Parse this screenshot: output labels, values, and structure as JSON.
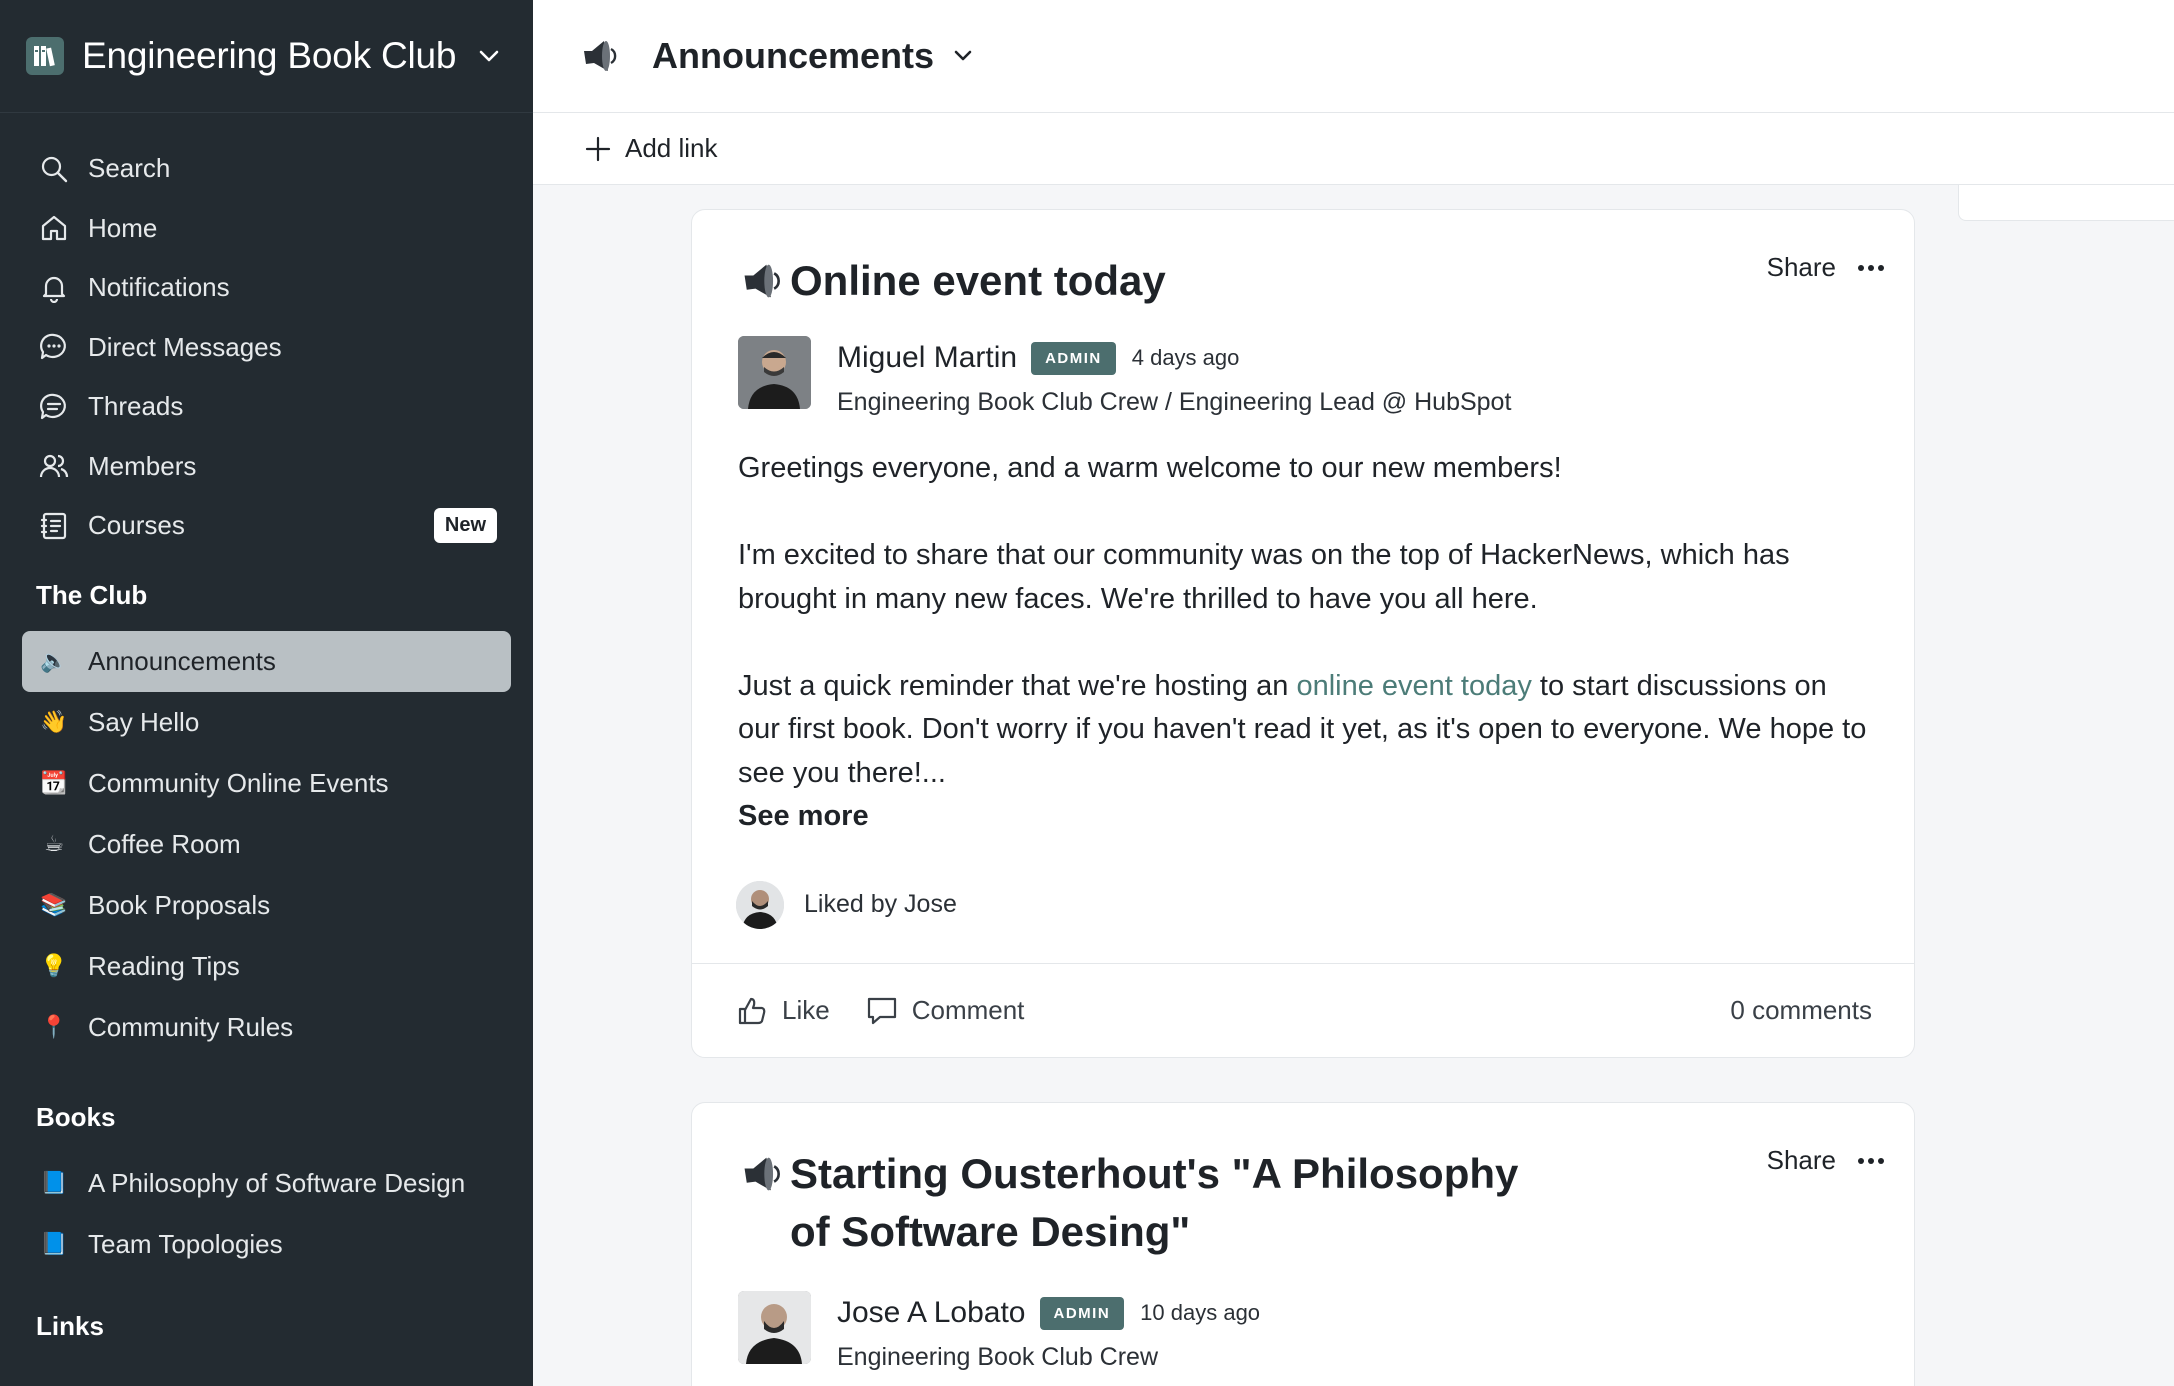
{
  "brand": {
    "title": "Engineering Book Club"
  },
  "nav": {
    "items": [
      {
        "label": "Search",
        "icon": "search-icon"
      },
      {
        "label": "Home",
        "icon": "home-icon"
      },
      {
        "label": "Notifications",
        "icon": "bell-icon"
      },
      {
        "label": "Direct Messages",
        "icon": "chat-bubble-icon"
      },
      {
        "label": "Threads",
        "icon": "threads-icon"
      },
      {
        "label": "Members",
        "icon": "members-icon"
      },
      {
        "label": "Courses",
        "icon": "courses-icon",
        "badge": "New"
      }
    ]
  },
  "club": {
    "title": "The Club",
    "channels": [
      {
        "label": "Announcements",
        "emoji": "🔈",
        "active": true
      },
      {
        "label": "Say Hello",
        "emoji": "👋"
      },
      {
        "label": "Community Online Events",
        "emoji": "📆"
      },
      {
        "label": "Coffee Room",
        "emoji": "☕"
      },
      {
        "label": "Book Proposals",
        "emoji": "📚"
      },
      {
        "label": "Reading Tips",
        "emoji": "💡"
      },
      {
        "label": "Community Rules",
        "emoji": "📍"
      }
    ]
  },
  "books": {
    "title": "Books",
    "channels": [
      {
        "label": "A Philosophy of Software Design",
        "emoji": "📘"
      },
      {
        "label": "Team Topologies",
        "emoji": "📘"
      }
    ]
  },
  "links": {
    "title": "Links"
  },
  "header": {
    "title": "Announcements",
    "add_link": "Add link"
  },
  "posts": [
    {
      "title": "Online event today",
      "share": "Share",
      "author": "Miguel Martin",
      "badge": "ADMIN",
      "time": "4 days ago",
      "subtitle": "Engineering Book Club Crew / Engineering Lead @ HubSpot",
      "p1": "Greetings everyone, and a warm welcome to our new members!",
      "p2": "I'm excited to share that our community was on the top of HackerNews, which has brought in many new faces. We're thrilled to have you all here.",
      "p3_before": "Just a quick reminder that we're hosting an ",
      "p3_link": "online event today",
      "p3_after": " to start discussions on our first book. Don't worry if you haven't read it yet, as it's open to everyone. We hope to see you there!...",
      "see_more": "See more",
      "liked_by": "Liked by Jose",
      "like": "Like",
      "comment": "Comment",
      "comments_count": "0 comments"
    },
    {
      "title": "Starting Ousterhout's \"A Philosophy of Software Desing\"",
      "share": "Share",
      "author": "Jose A Lobato",
      "badge": "ADMIN",
      "time": "10 days ago",
      "subtitle": "Engineering Book Club Crew"
    }
  ],
  "colors": {
    "sidebar": "#232b31",
    "accent": "#4c6e6e",
    "link": "#4c7c78",
    "active": "#b9c0c4"
  }
}
